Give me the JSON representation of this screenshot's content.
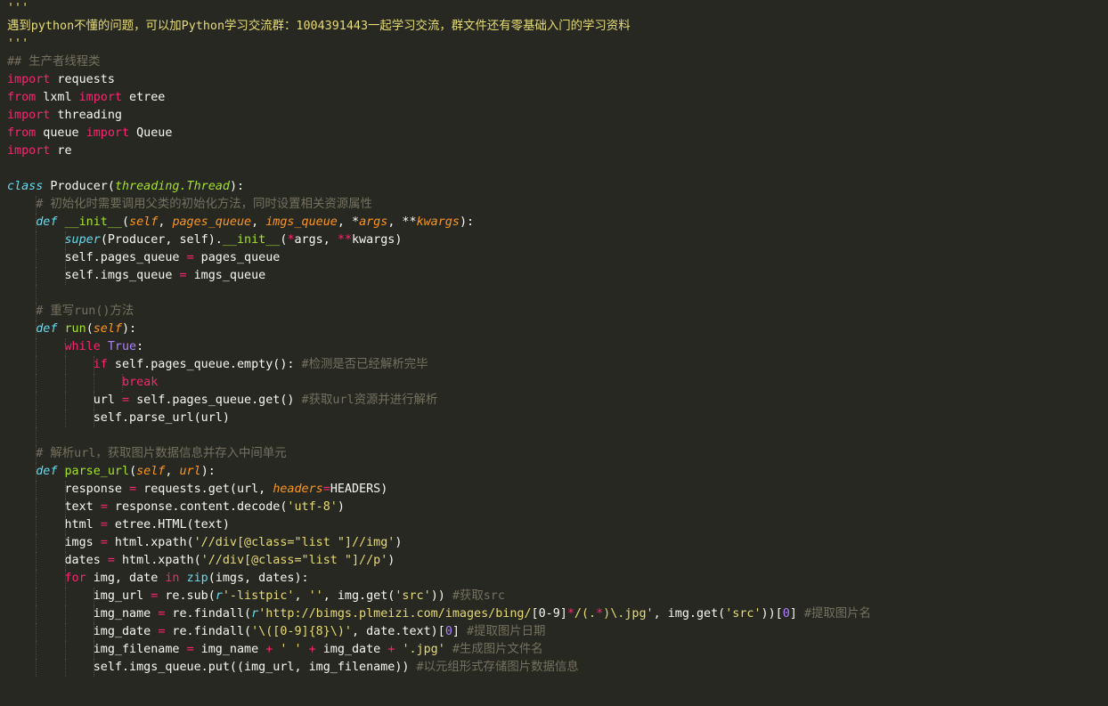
{
  "colors": {
    "background": "#272822",
    "default": "#f8f8f2",
    "comment": "#75715e",
    "docstring": "#e6db74",
    "keyword": "#f92672",
    "storage": "#66d9ef",
    "function": "#a6e22e",
    "builtin": "#66d9ef",
    "param": "#fd971f",
    "string": "#e6db74",
    "number": "#ae81ff",
    "constant": "#ae81ff",
    "indent_guide": "#4b4c44"
  },
  "code_lines": [
    {
      "indent": 0,
      "tokens": [
        [
          "'''",
          "docstring"
        ]
      ]
    },
    {
      "indent": 0,
      "tokens": [
        [
          "遇到python不懂的问题，可以加Python学习交流群：1004391443一起学习交流，群文件还有零基础入门的学习资料",
          "docstring"
        ]
      ]
    },
    {
      "indent": 0,
      "tokens": [
        [
          "'''",
          "docstring"
        ]
      ]
    },
    {
      "indent": 0,
      "tokens": [
        [
          "## 生产者线程类",
          "comment"
        ]
      ]
    },
    {
      "indent": 0,
      "tokens": [
        [
          "import",
          "keyword"
        ],
        [
          " requests",
          "default"
        ]
      ]
    },
    {
      "indent": 0,
      "tokens": [
        [
          "from",
          "keyword"
        ],
        [
          " lxml ",
          "default"
        ],
        [
          "import",
          "keyword"
        ],
        [
          " etree",
          "default"
        ]
      ]
    },
    {
      "indent": 0,
      "tokens": [
        [
          "import",
          "keyword"
        ],
        [
          " threading",
          "default"
        ]
      ]
    },
    {
      "indent": 0,
      "tokens": [
        [
          "from",
          "keyword"
        ],
        [
          " queue ",
          "default"
        ],
        [
          "import",
          "keyword"
        ],
        [
          " Queue",
          "default"
        ]
      ]
    },
    {
      "indent": 0,
      "tokens": [
        [
          "import",
          "keyword"
        ],
        [
          " re",
          "default"
        ]
      ]
    },
    {
      "indent": 0,
      "tokens": []
    },
    {
      "indent": 0,
      "tokens": [
        [
          "class",
          "storage_italic"
        ],
        [
          " Producer(",
          "default"
        ],
        [
          "threading.Thread",
          "function_italic"
        ],
        [
          "):",
          "default"
        ]
      ]
    },
    {
      "indent": 1,
      "tokens": [
        [
          "# 初始化时需要调用父类的初始化方法，同时设置相关资源属性",
          "comment"
        ]
      ]
    },
    {
      "indent": 1,
      "tokens": [
        [
          "def",
          "storage_italic"
        ],
        [
          " __init__",
          "function"
        ],
        [
          "(",
          "default"
        ],
        [
          "self",
          "param_italic"
        ],
        [
          ", ",
          "default"
        ],
        [
          "pages_queue",
          "param_italic"
        ],
        [
          ", ",
          "default"
        ],
        [
          "imgs_queue",
          "param_italic"
        ],
        [
          ", *",
          "default"
        ],
        [
          "args",
          "param_italic"
        ],
        [
          ", **",
          "default"
        ],
        [
          "kwargs",
          "param_italic"
        ],
        [
          "):",
          "default"
        ]
      ]
    },
    {
      "indent": 2,
      "tokens": [
        [
          "super",
          "builtin_italic"
        ],
        [
          "(Producer, self).",
          "default"
        ],
        [
          "__init__",
          "function"
        ],
        [
          "(",
          "default"
        ],
        [
          "*",
          "keyword"
        ],
        [
          "args, ",
          "default"
        ],
        [
          "**",
          "keyword"
        ],
        [
          "kwargs)",
          "default"
        ]
      ]
    },
    {
      "indent": 2,
      "tokens": [
        [
          "self.pages_queue ",
          "default"
        ],
        [
          "=",
          "keyword"
        ],
        [
          " pages_queue",
          "default"
        ]
      ]
    },
    {
      "indent": 2,
      "tokens": [
        [
          "self.imgs_queue ",
          "default"
        ],
        [
          "=",
          "keyword"
        ],
        [
          " imgs_queue",
          "default"
        ]
      ]
    },
    {
      "indent": 1,
      "tokens": []
    },
    {
      "indent": 1,
      "tokens": [
        [
          "# 重写run()方法",
          "comment"
        ]
      ]
    },
    {
      "indent": 1,
      "tokens": [
        [
          "def",
          "storage_italic"
        ],
        [
          " run",
          "function"
        ],
        [
          "(",
          "default"
        ],
        [
          "self",
          "param_italic"
        ],
        [
          "):",
          "default"
        ]
      ]
    },
    {
      "indent": 2,
      "tokens": [
        [
          "while",
          "keyword"
        ],
        [
          " ",
          "default"
        ],
        [
          "True",
          "constant"
        ],
        [
          ":",
          "default"
        ]
      ]
    },
    {
      "indent": 3,
      "tokens": [
        [
          "if",
          "keyword"
        ],
        [
          " self.pages_queue.empty(): ",
          "default"
        ],
        [
          "#检测是否已经解析完毕",
          "comment"
        ]
      ]
    },
    {
      "indent": 4,
      "tokens": [
        [
          "break",
          "keyword"
        ]
      ]
    },
    {
      "indent": 3,
      "tokens": [
        [
          "url ",
          "default"
        ],
        [
          "=",
          "keyword"
        ],
        [
          " self.pages_queue.get() ",
          "default"
        ],
        [
          "#获取url资源并进行解析",
          "comment"
        ]
      ]
    },
    {
      "indent": 3,
      "tokens": [
        [
          "self.parse_url(url)",
          "default"
        ]
      ]
    },
    {
      "indent": 1,
      "tokens": []
    },
    {
      "indent": 1,
      "tokens": [
        [
          "# 解析url，获取图片数据信息并存入中间单元",
          "comment"
        ]
      ]
    },
    {
      "indent": 1,
      "tokens": [
        [
          "def",
          "storage_italic"
        ],
        [
          " parse_url",
          "function"
        ],
        [
          "(",
          "default"
        ],
        [
          "self",
          "param_italic"
        ],
        [
          ", ",
          "default"
        ],
        [
          "url",
          "param_italic"
        ],
        [
          "):",
          "default"
        ]
      ]
    },
    {
      "indent": 2,
      "tokens": [
        [
          "response ",
          "default"
        ],
        [
          "=",
          "keyword"
        ],
        [
          " requests.get(url, ",
          "default"
        ],
        [
          "headers",
          "param_italic"
        ],
        [
          "=",
          "keyword"
        ],
        [
          "HEADERS)",
          "default"
        ]
      ]
    },
    {
      "indent": 2,
      "tokens": [
        [
          "text ",
          "default"
        ],
        [
          "=",
          "keyword"
        ],
        [
          " response.content.decode(",
          "default"
        ],
        [
          "'utf-8'",
          "string"
        ],
        [
          ")",
          "default"
        ]
      ]
    },
    {
      "indent": 2,
      "tokens": [
        [
          "html ",
          "default"
        ],
        [
          "=",
          "keyword"
        ],
        [
          " etree.HTML(text)",
          "default"
        ]
      ]
    },
    {
      "indent": 2,
      "tokens": [
        [
          "imgs ",
          "default"
        ],
        [
          "=",
          "keyword"
        ],
        [
          " html.xpath(",
          "default"
        ],
        [
          "'//div[@class=\"list \"]//img'",
          "string"
        ],
        [
          ")",
          "default"
        ]
      ]
    },
    {
      "indent": 2,
      "tokens": [
        [
          "dates ",
          "default"
        ],
        [
          "=",
          "keyword"
        ],
        [
          " html.xpath(",
          "default"
        ],
        [
          "'//div[@class=\"list \"]//p'",
          "string"
        ],
        [
          ")",
          "default"
        ]
      ]
    },
    {
      "indent": 2,
      "tokens": [
        [
          "for",
          "keyword"
        ],
        [
          " img, date ",
          "default"
        ],
        [
          "in",
          "keyword"
        ],
        [
          " ",
          "default"
        ],
        [
          "zip",
          "builtin"
        ],
        [
          "(imgs, dates):",
          "default"
        ]
      ]
    },
    {
      "indent": 3,
      "tokens": [
        [
          "img_url ",
          "default"
        ],
        [
          "=",
          "keyword"
        ],
        [
          " re.sub(",
          "default"
        ],
        [
          "r",
          "storage_italic"
        ],
        [
          "'-listpic'",
          "string"
        ],
        [
          ", ",
          "default"
        ],
        [
          "''",
          "string"
        ],
        [
          ", img.get(",
          "default"
        ],
        [
          "'src'",
          "string"
        ],
        [
          ")) ",
          "default"
        ],
        [
          "#获取src",
          "comment"
        ]
      ]
    },
    {
      "indent": 3,
      "tokens": [
        [
          "img_name ",
          "default"
        ],
        [
          "=",
          "keyword"
        ],
        [
          " re.findall(",
          "default"
        ],
        [
          "r",
          "storage_italic"
        ],
        [
          "'http://bimgs.plmeizi.com/images/bing/",
          "string"
        ],
        [
          "[0-9]",
          "default"
        ],
        [
          "*",
          "keyword"
        ],
        [
          "/(.",
          "string"
        ],
        [
          "*",
          "keyword"
        ],
        [
          ")\\.jpg'",
          "string"
        ],
        [
          ", img.get(",
          "default"
        ],
        [
          "'src'",
          "string"
        ],
        [
          "))[",
          "default"
        ],
        [
          "0",
          "number"
        ],
        [
          "] ",
          "default"
        ],
        [
          "#提取图片名",
          "comment"
        ]
      ]
    },
    {
      "indent": 3,
      "tokens": [
        [
          "img_date ",
          "default"
        ],
        [
          "=",
          "keyword"
        ],
        [
          " re.findall(",
          "default"
        ],
        [
          "'\\([0-9]{8}\\)'",
          "string"
        ],
        [
          ", date.text)[",
          "default"
        ],
        [
          "0",
          "number"
        ],
        [
          "] ",
          "default"
        ],
        [
          "#提取图片日期",
          "comment"
        ]
      ]
    },
    {
      "indent": 3,
      "tokens": [
        [
          "img_filename ",
          "default"
        ],
        [
          "=",
          "keyword"
        ],
        [
          " img_name ",
          "default"
        ],
        [
          "+",
          "keyword"
        ],
        [
          " ",
          "default"
        ],
        [
          "' '",
          "string"
        ],
        [
          " ",
          "default"
        ],
        [
          "+",
          "keyword"
        ],
        [
          " img_date ",
          "default"
        ],
        [
          "+",
          "keyword"
        ],
        [
          " ",
          "default"
        ],
        [
          "'.jpg'",
          "string"
        ],
        [
          " ",
          "default"
        ],
        [
          "#生成图片文件名",
          "comment"
        ]
      ]
    },
    {
      "indent": 3,
      "tokens": [
        [
          "self.imgs_queue.put((img_url, img_filename)) ",
          "default"
        ],
        [
          "#以元组形式存储图片数据信息",
          "comment"
        ]
      ]
    }
  ]
}
